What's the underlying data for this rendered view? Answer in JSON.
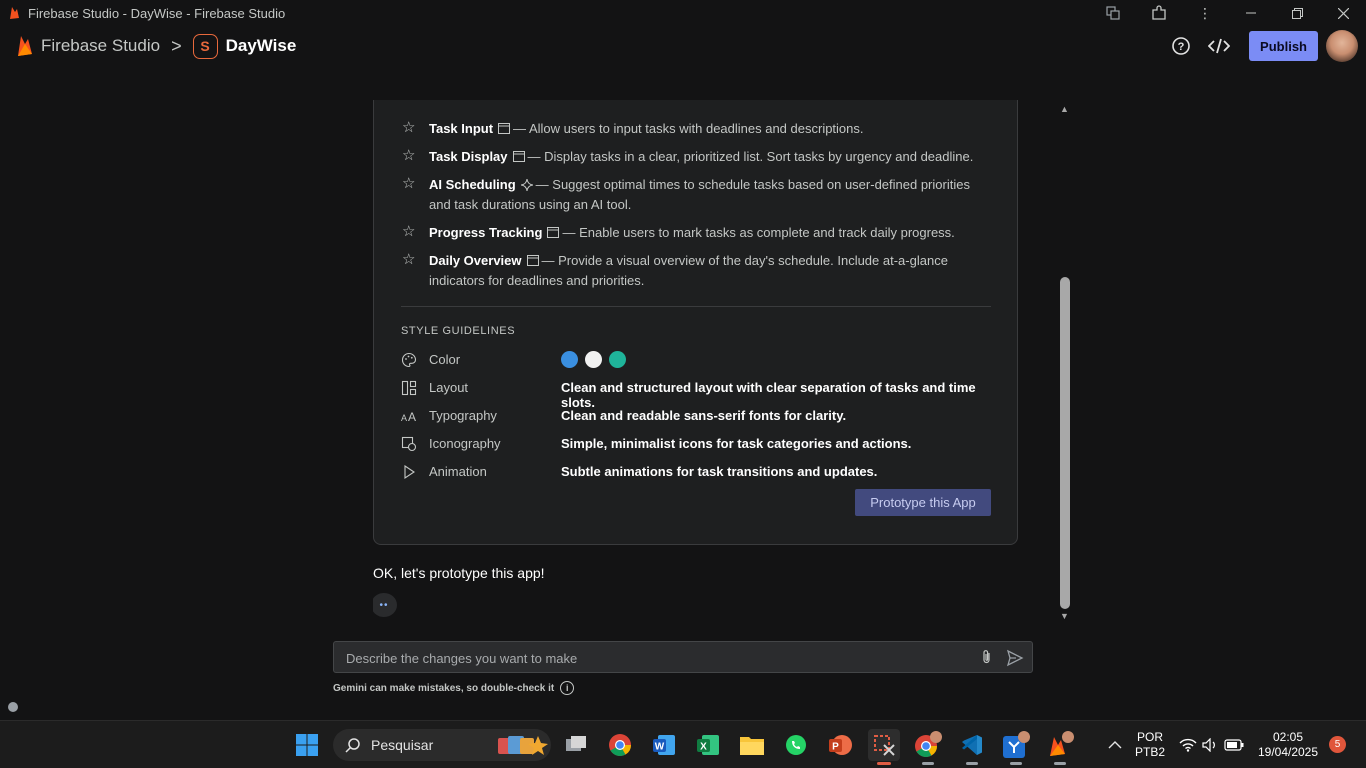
{
  "window": {
    "title": "Firebase Studio - DayWise - Firebase Studio",
    "controls": [
      "minimize-icon",
      "restore-icon",
      "close-icon"
    ]
  },
  "header": {
    "brand": "Firebase Studio",
    "separator": ">",
    "project_initial": "S",
    "project": "DayWise",
    "publish_label": "Publish"
  },
  "features": [
    {
      "name": "Task Input",
      "desc": "— Allow users to input tasks with deadlines and descriptions.",
      "icon": "panel-icon"
    },
    {
      "name": "Task Display",
      "desc": "— Display tasks in a clear, prioritized list. Sort tasks by urgency and deadline.",
      "icon": "panel-icon"
    },
    {
      "name": "AI Scheduling",
      "desc": "— Suggest optimal times to schedule tasks based on user-defined priorities and task durations using an AI tool.",
      "icon": "sparkle-icon"
    },
    {
      "name": "Progress Tracking",
      "desc": "— Enable users to mark tasks as complete and track daily progress.",
      "icon": "panel-icon"
    },
    {
      "name": "Daily Overview",
      "desc": "— Provide a visual overview of the day's schedule. Include at-a-glance indicators for deadlines and priorities.",
      "icon": "panel-icon"
    }
  ],
  "style_guidelines": {
    "title": "STYLE GUIDELINES",
    "color_label": "Color",
    "colors": [
      "#3a8fe0",
      "#f1f1f1",
      "#1fb49a"
    ],
    "rows": [
      {
        "label": "Layout",
        "value": "Clean and structured layout with clear separation of tasks and time slots.",
        "icon": "layout-icon"
      },
      {
        "label": "Typography",
        "value": "Clean and readable sans-serif fonts for clarity.",
        "icon": "typography-icon"
      },
      {
        "label": "Iconography",
        "value": "Simple, minimalist icons for task categories and actions.",
        "icon": "iconography-icon"
      },
      {
        "label": "Animation",
        "value": "Subtle animations for task transitions and updates.",
        "icon": "play-icon"
      }
    ]
  },
  "prototype_button": "Prototype this App",
  "reply": "OK, let's prototype this app!",
  "loading": "••",
  "composer": {
    "placeholder": "Describe the changes you want to make",
    "disclaimer": "Gemini can make mistakes, so double-check it"
  },
  "taskbar": {
    "search_label": "Pesquisar",
    "language": "POR",
    "layout": "PTB2",
    "time": "02:05",
    "date": "19/04/2025",
    "notifications": "5"
  }
}
